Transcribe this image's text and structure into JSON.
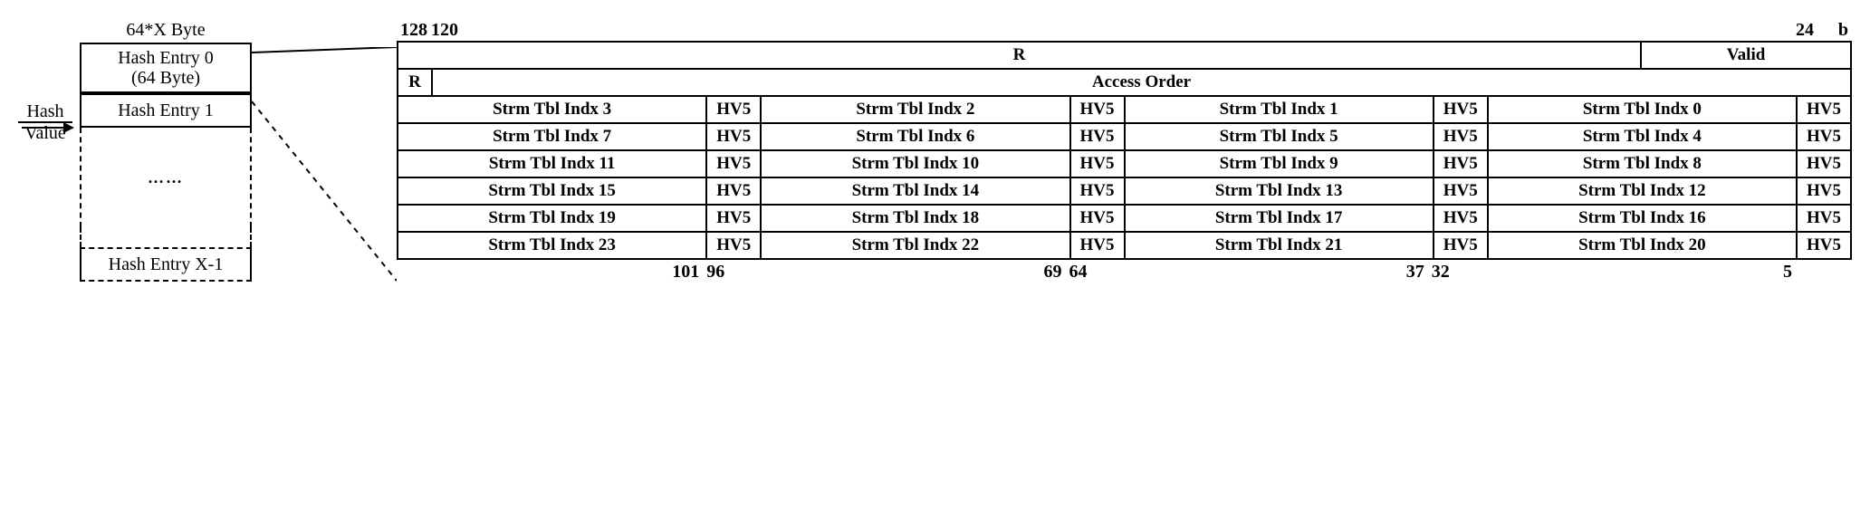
{
  "left": {
    "hash_value_line1": "Hash",
    "hash_value_line2": "Value",
    "table_title": "64*X Byte",
    "entry0_line1": "Hash Entry 0",
    "entry0_line2": "(64 Byte)",
    "entry1": "Hash Entry 1",
    "dots": "……",
    "entry_last": "Hash Entry X-1"
  },
  "top_marks": {
    "m128": "128",
    "m120": "120",
    "m24": "24",
    "mb": "b"
  },
  "header": {
    "R_big": "R",
    "Valid": "Valid",
    "R_small": "R",
    "AccessOrder": "Access Order"
  },
  "hv_label": "HV5",
  "rows": [
    [
      "Strm Tbl Indx 3",
      "Strm Tbl Indx 2",
      "Strm Tbl Indx 1",
      "Strm Tbl Indx 0"
    ],
    [
      "Strm Tbl Indx 7",
      "Strm Tbl Indx 6",
      "Strm Tbl Indx 5",
      "Strm Tbl Indx 4"
    ],
    [
      "Strm Tbl Indx 11",
      "Strm Tbl Indx 10",
      "Strm Tbl Indx 9",
      "Strm Tbl Indx 8"
    ],
    [
      "Strm Tbl Indx 15",
      "Strm Tbl Indx 14",
      "Strm Tbl Indx 13",
      "Strm Tbl Indx 12"
    ],
    [
      "Strm Tbl Indx 19",
      "Strm Tbl Indx 18",
      "Strm Tbl Indx 17",
      "Strm Tbl Indx 16"
    ],
    [
      "Strm Tbl Indx 23",
      "Strm Tbl Indx 22",
      "Strm Tbl Indx 21",
      "Strm Tbl Indx 20"
    ]
  ],
  "bottom_marks": {
    "m101": "101",
    "m96": "96",
    "m69": "69",
    "m64": "64",
    "m37": "37",
    "m32": "32",
    "m5": "5"
  }
}
